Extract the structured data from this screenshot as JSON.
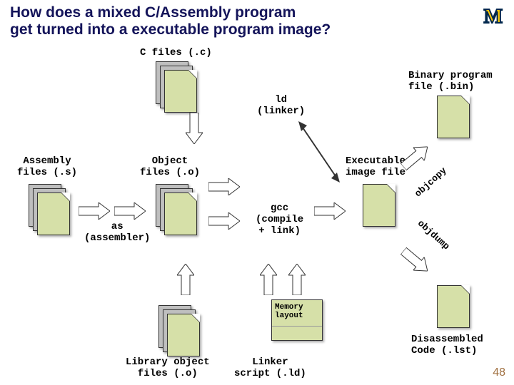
{
  "title": "How does a mixed C/Assembly program\nget turned into a executable program image?",
  "page_number": "48",
  "labels": {
    "c_files": "C files (.c)",
    "asm_files": "Assembly\nfiles (.s)",
    "object_files": "Object\nfiles (.o)",
    "as": "as\n(assembler)",
    "ld": "ld\n(linker)",
    "gcc": "gcc\n(compile\n+ link)",
    "exec": "Executable\nimage file",
    "bin": "Binary program\nfile (.bin)",
    "libobj": "Library object\nfiles (.o)",
    "linker_script": "Linker\nscript (.ld)",
    "memory_layout": "Memory\nlayout",
    "objcopy": "objcopy",
    "objdump": "objdump",
    "disasm": "Disassembled\nCode (.lst)"
  },
  "logo_text": "M"
}
